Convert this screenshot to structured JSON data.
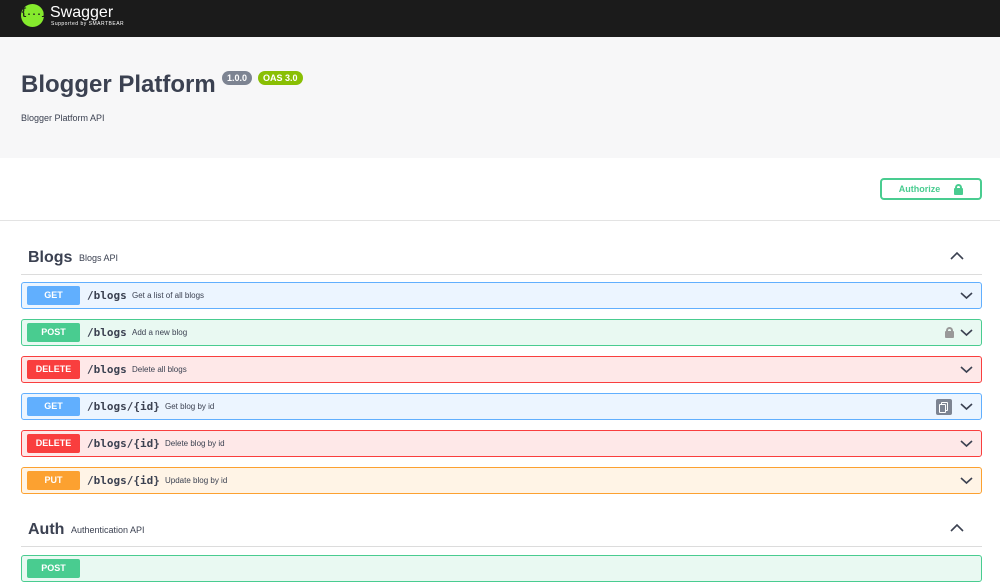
{
  "topbar": {
    "logo_glyph": "{...}",
    "logo_title": "Swagger",
    "logo_subtitle": "Supported by SMARTBEAR"
  },
  "info": {
    "title": "Blogger Platform",
    "version": "1.0.0",
    "oas": "OAS 3.0",
    "description": "Blogger Platform API"
  },
  "authorize": {
    "label": "Authorize",
    "icon": "lock-icon"
  },
  "tags": [
    {
      "name": "Blogs",
      "description": "Blogs API",
      "operations": [
        {
          "method": "GET",
          "path": "/blogs",
          "summary": "Get a list of all blogs"
        },
        {
          "method": "POST",
          "path": "/blogs",
          "summary": "Add a new blog",
          "icon": "lock-icon"
        },
        {
          "method": "DELETE",
          "path": "/blogs",
          "summary": "Delete all blogs"
        },
        {
          "method": "GET",
          "path": "/blogs/{id}",
          "summary": "Get blog by id",
          "icon": "copy-icon"
        },
        {
          "method": "DELETE",
          "path": "/blogs/{id}",
          "summary": "Delete blog by id"
        },
        {
          "method": "PUT",
          "path": "/blogs/{id}",
          "summary": "Update blog by id"
        }
      ]
    },
    {
      "name": "Auth",
      "description": "Authentication API",
      "operations": [
        {
          "method": "POST",
          "path": "",
          "summary": ""
        }
      ]
    }
  ],
  "colors": {
    "get": "#61affe",
    "post": "#49cc90",
    "delete": "#f93e3e",
    "put": "#fca130",
    "topbar": "#1b1b1b",
    "logo": "#85ea2d"
  }
}
